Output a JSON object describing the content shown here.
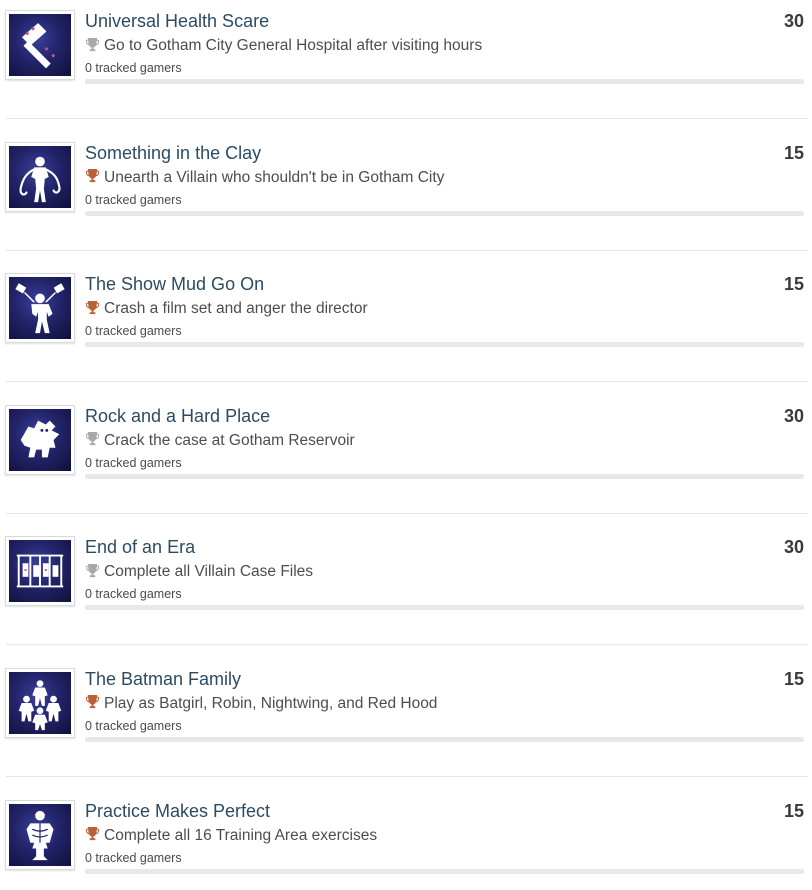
{
  "colors": {
    "title": "#2c4b63",
    "trophy_silver": "#a9a9a9",
    "trophy_bronze": "#b8623a",
    "bar_track": "#e6e8ea"
  },
  "achievements": [
    {
      "title": "Universal Health Scare",
      "description": "Go to Gotham City General Hospital after visiting hours",
      "tracked": "0 tracked gamers",
      "points": "30",
      "trophy": "silver",
      "icon": "hammer-icon",
      "progress": 0
    },
    {
      "title": "Something in the Clay",
      "description": "Unearth a Villain who shouldn't be in Gotham City",
      "tracked": "0 tracked gamers",
      "points": "15",
      "trophy": "bronze",
      "icon": "clay-villain-icon",
      "progress": 0
    },
    {
      "title": "The Show Mud Go On",
      "description": "Crash a film set and anger the director",
      "tracked": "0 tracked gamers",
      "points": "15",
      "trophy": "bronze",
      "icon": "film-set-icon",
      "progress": 0
    },
    {
      "title": "Rock and a Hard Place",
      "description": "Crack the case at Gotham Reservoir",
      "tracked": "0 tracked gamers",
      "points": "30",
      "trophy": "silver",
      "icon": "rock-monster-icon",
      "progress": 0
    },
    {
      "title": "End of an Era",
      "description": "Complete all Villain Case Files",
      "tracked": "0 tracked gamers",
      "points": "30",
      "trophy": "silver",
      "icon": "jail-cells-icon",
      "progress": 0
    },
    {
      "title": "The Batman Family",
      "description": "Play as Batgirl, Robin, Nightwing, and Red Hood",
      "tracked": "0 tracked gamers",
      "points": "15",
      "trophy": "bronze",
      "icon": "bat-family-icon",
      "progress": 0
    },
    {
      "title": "Practice Makes Perfect",
      "description": "Complete all 16 Training Area exercises",
      "tracked": "0 tracked gamers",
      "points": "15",
      "trophy": "bronze",
      "icon": "training-dummy-icon",
      "progress": 0
    }
  ]
}
